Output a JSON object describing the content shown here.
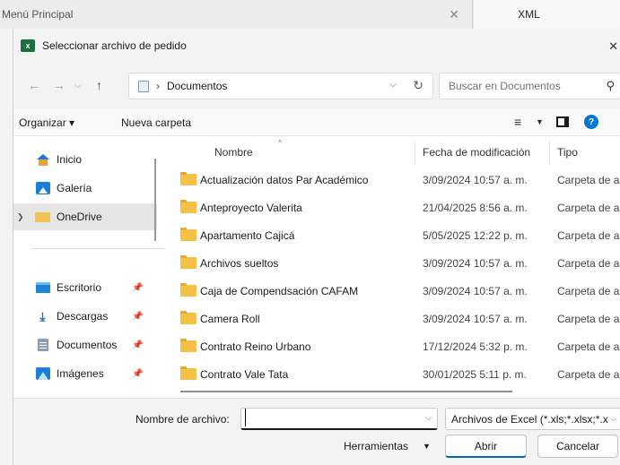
{
  "background_tabs": {
    "left_title": "Menú Principal",
    "right_title": "XML"
  },
  "dialog": {
    "title": "Seleccionar archivo de pedido",
    "excel_badge": "x"
  },
  "address": {
    "path": "Documentos",
    "separator": "›",
    "search_placeholder": "Buscar en Documentos"
  },
  "toolbar": {
    "organize": "Organizar ▾",
    "new_folder": "Nueva carpeta",
    "help": "?"
  },
  "sidebar": {
    "items": [
      {
        "label": "Inicio",
        "icon": "home-icon"
      },
      {
        "label": "Galería",
        "icon": "gallery-icon"
      },
      {
        "label": "OneDrive",
        "icon": "onedrive-folder-icon"
      },
      {
        "label": "Escritorio",
        "icon": "desktop-icon"
      },
      {
        "label": "Descargas",
        "icon": "download-icon"
      },
      {
        "label": "Documentos",
        "icon": "documents-icon"
      },
      {
        "label": "Imágenes",
        "icon": "images-icon"
      }
    ]
  },
  "files": {
    "columns": {
      "name": "Nombre",
      "date": "Fecha de modificación",
      "type": "Tipo"
    },
    "rows": [
      {
        "name": "Actualización datos Par Académico",
        "date": "3/09/2024 10:57 a. m.",
        "type": "Carpeta de archivos"
      },
      {
        "name": "Anteproyecto Valerita",
        "date": "21/04/2025 8:56 a. m.",
        "type": "Carpeta de archivos"
      },
      {
        "name": "Apartamento Cajicá",
        "date": "5/05/2025 12:22 p. m.",
        "type": "Carpeta de archivos"
      },
      {
        "name": "Archivos sueltos",
        "date": "3/09/2024 10:57 a. m.",
        "type": "Carpeta de archivos"
      },
      {
        "name": "Caja de Compendsación CAFAM",
        "date": "3/09/2024 10:57 a. m.",
        "type": "Carpeta de archivos"
      },
      {
        "name": "Camera Roll",
        "date": "3/09/2024 10:57 a. m.",
        "type": "Carpeta de archivos"
      },
      {
        "name": "Contrato Reino Urbano",
        "date": "17/12/2024 5:32 p. m.",
        "type": "Carpeta de archivos"
      },
      {
        "name": "Contrato Vale Tata",
        "date": "30/01/2025 5:11 p. m.",
        "type": "Carpeta de archivos"
      }
    ]
  },
  "bottom": {
    "filename_label": "Nombre de archivo:",
    "filename_value": "",
    "filetype": "Archivos de Excel (*.xls;*.xlsx;*.x",
    "tools": "Herramientas",
    "open": "Abrir",
    "cancel": "Cancelar"
  },
  "colors": {
    "accent": "#0067c0",
    "excel_green": "#1d6f42",
    "folder": "#f4c047"
  }
}
